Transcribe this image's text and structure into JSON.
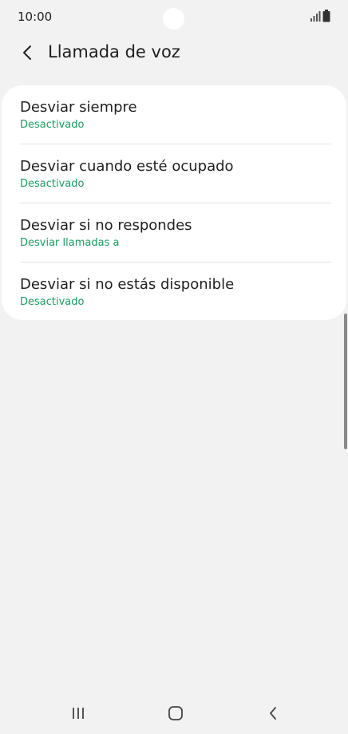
{
  "status_bar": {
    "time": "10:00",
    "icons": [
      "signal-icon",
      "battery-icon"
    ]
  },
  "header": {
    "title": "Llamada de voz",
    "back_icon": "chevron-left-icon"
  },
  "list": {
    "items": [
      {
        "title": "Desviar siempre",
        "subtitle": "Desactivado"
      },
      {
        "title": "Desviar cuando esté ocupado",
        "subtitle": "Desactivado"
      },
      {
        "title": "Desviar si no respondes",
        "subtitle": "Desviar llamadas a"
      },
      {
        "title": "Desviar si no estás disponible",
        "subtitle": "Desactivado"
      }
    ]
  },
  "navigation": {
    "buttons": [
      "recent-apps-icon",
      "home-icon",
      "back-icon"
    ]
  },
  "colors": {
    "accent": "#199c5f",
    "background": "#f2f2f2",
    "card": "#ffffff"
  }
}
